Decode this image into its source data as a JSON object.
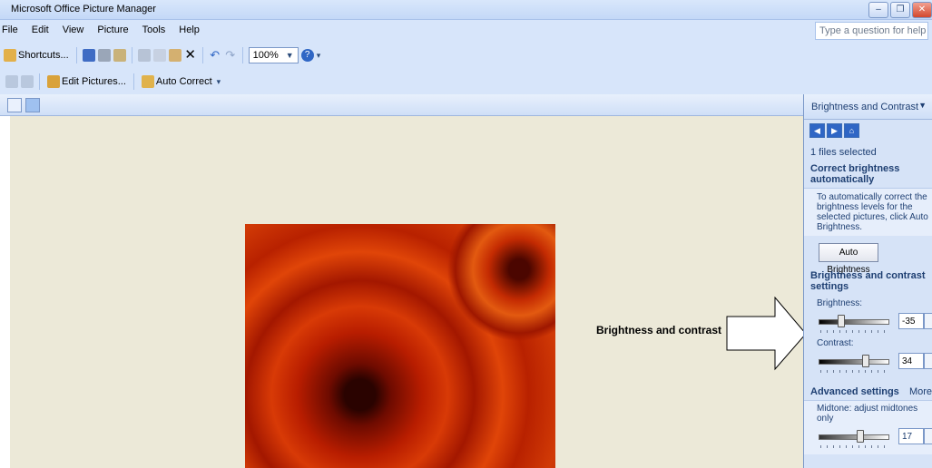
{
  "window": {
    "title": "Microsoft Office Picture Manager"
  },
  "menu": {
    "items": [
      "File",
      "Edit",
      "View",
      "Picture",
      "Tools",
      "Help"
    ]
  },
  "help": {
    "placeholder": "Type a question for help"
  },
  "toolbar": {
    "shortcuts_label": "Shortcuts...",
    "zoom": "100%",
    "edit_pictures_label": "Edit Pictures...",
    "auto_correct_label": "Auto Correct"
  },
  "annotation": {
    "text": "Brightness and contrast"
  },
  "panel": {
    "title": "Brightness and Contrast",
    "files_selected": "1 files selected",
    "correct_heading": "Correct brightness automatically",
    "correct_desc": "To automatically correct the brightness levels for the selected pictures, click Auto Brightness.",
    "auto_button": "Auto Brightness",
    "settings_heading": "Brightness and contrast settings",
    "brightness_label": "Brightness:",
    "brightness_value": "-35",
    "brightness_level": -35,
    "contrast_label": "Contrast:",
    "contrast_value": "34",
    "contrast_level": 34,
    "advanced_heading": "Advanced settings",
    "more_label": "More",
    "midtone_label": "Midtone: adjust midtones only",
    "midtone_value": "17",
    "midtone_level": 17
  },
  "colors": {
    "chrome": "#d7e5fa",
    "workspace": "#ece9d8",
    "panel_text": "#1e3f72"
  }
}
